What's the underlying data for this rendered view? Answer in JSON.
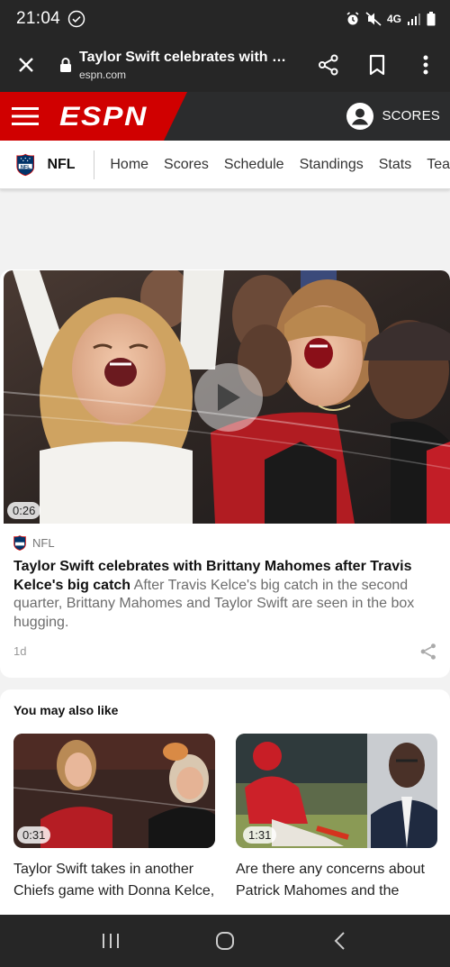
{
  "status_bar": {
    "time": "21:04",
    "network": "4G",
    "icons": [
      "check-circle-icon",
      "alarm-icon",
      "mute-icon",
      "signal-icon",
      "battery-icon"
    ]
  },
  "browser": {
    "page_title": "Taylor Swift celebrates with Bri...",
    "domain": "espn.com",
    "icons": [
      "close-icon",
      "lock-icon",
      "share-icon",
      "bookmark-icon",
      "more-vert-icon"
    ]
  },
  "header": {
    "logo": "ESPN",
    "scores_label": "SCORES",
    "brand_color": "#d00000"
  },
  "sub_nav": {
    "section": "NFL",
    "items": [
      "Home",
      "Scores",
      "Schedule",
      "Standings",
      "Stats",
      "Tea"
    ]
  },
  "article": {
    "duration": "0:26",
    "category": "NFL",
    "headline": "Taylor Swift celebrates with Brittany Mahomes after Travis Kelce's big catch",
    "description": "After Travis Kelce's big catch in the second quarter, Brittany Mahomes and Taylor Swift are seen in the box hugging.",
    "age": "1d"
  },
  "related": {
    "title": "You may also like",
    "items": [
      {
        "duration": "0:31",
        "title": "Taylor Swift takes in another Chiefs game with Donna Kelce, Brittany Mahomes"
      },
      {
        "duration": "1:31",
        "title": "Are there any concerns about Patrick Mahomes and the Chiefs?"
      }
    ]
  },
  "android_nav": {
    "icons": [
      "recents-icon",
      "home-icon",
      "back-icon"
    ]
  }
}
